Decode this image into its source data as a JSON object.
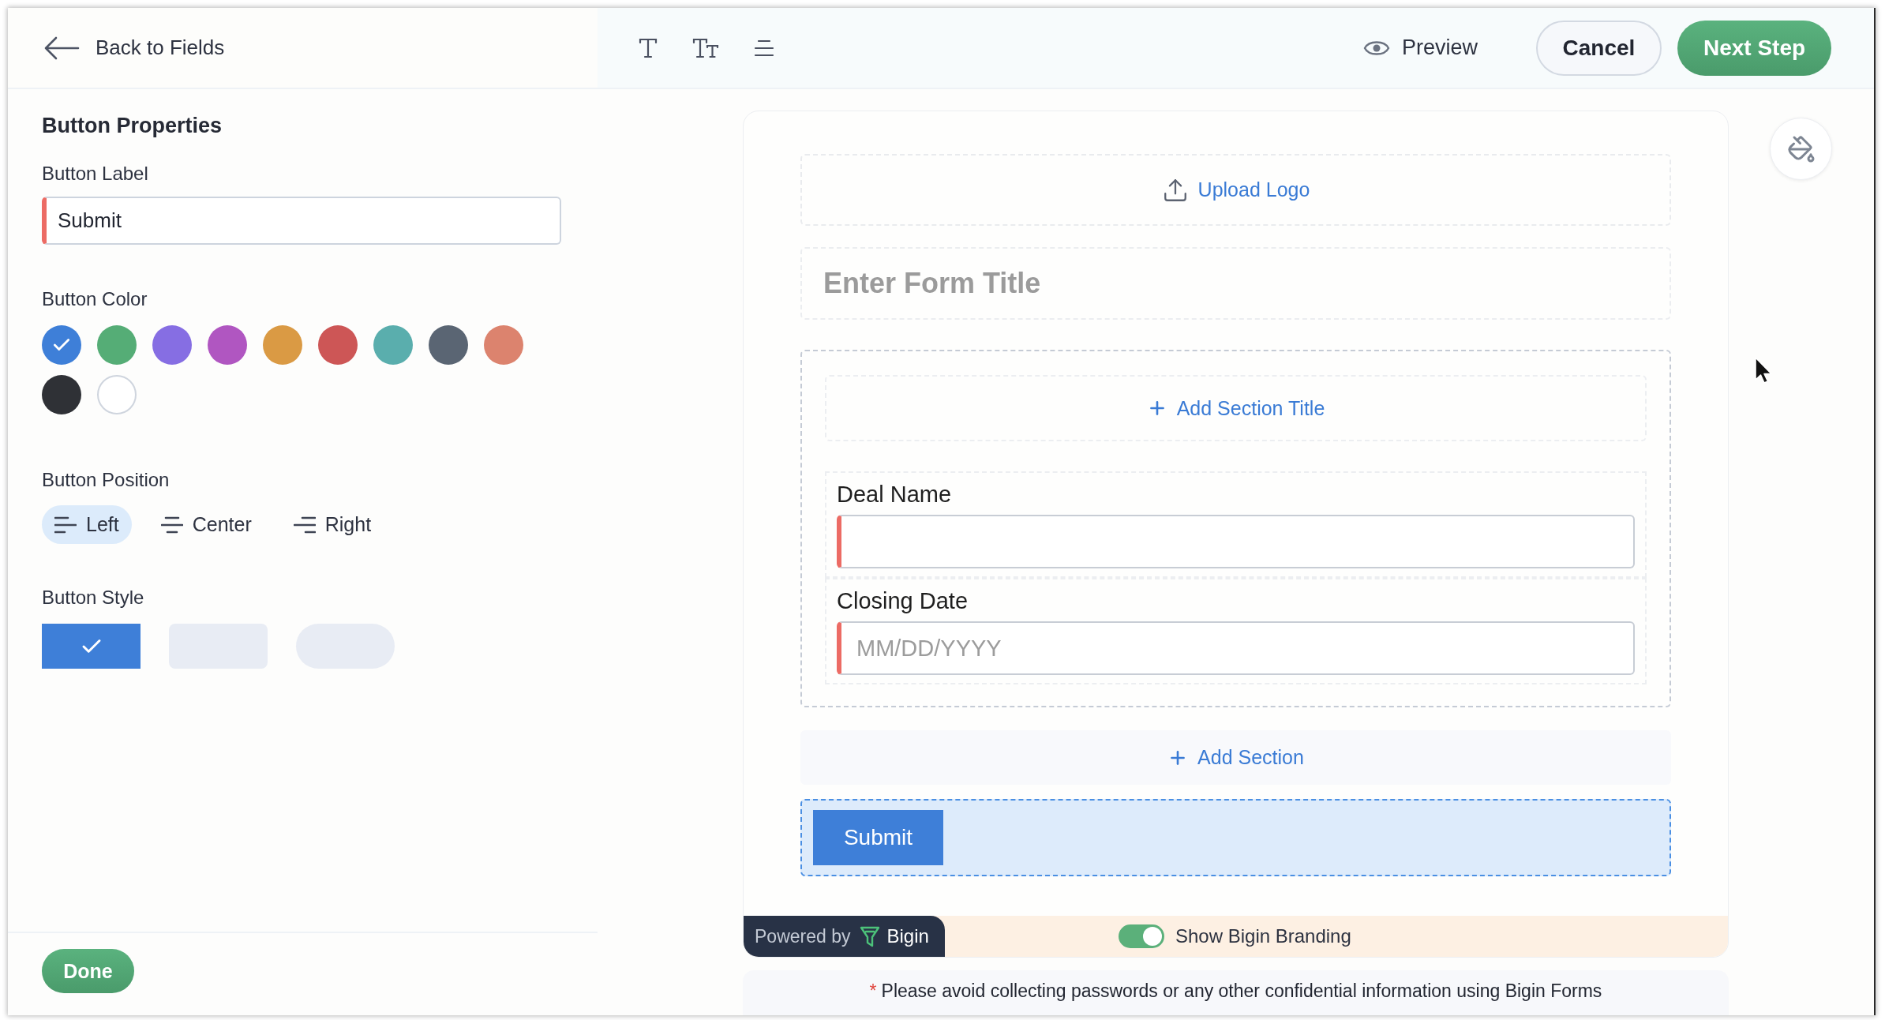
{
  "top_bar": {
    "back_link": "Back to Fields",
    "preview": "Preview",
    "buttons": [
      {
        "label": "Cancel",
        "kind": "secondary"
      },
      {
        "label": "Next Step",
        "kind": "primary"
      }
    ]
  },
  "properties_panel": {
    "title": "Button Properties",
    "label_field": {
      "label": "Button Label",
      "value": "Submit",
      "required": true
    },
    "color": {
      "label": "Button Color",
      "swatches": [
        {
          "color": "#3e7fd8",
          "selected": true
        },
        {
          "color": "#55ad76",
          "selected": false
        },
        {
          "color": "#866ee3",
          "selected": false
        },
        {
          "color": "#b056c1",
          "selected": false
        },
        {
          "color": "#da9a44",
          "selected": false
        },
        {
          "color": "#cd5656",
          "selected": false
        },
        {
          "color": "#5aaead",
          "selected": false
        },
        {
          "color": "#5a6573",
          "selected": false
        },
        {
          "color": "#dc836e",
          "selected": false
        },
        {
          "color": "#2f3136",
          "selected": false
        },
        {
          "color": "#ffffff",
          "selected": false
        }
      ]
    },
    "position": {
      "label": "Button Position",
      "options": [
        {
          "label": "Left",
          "kind": "left",
          "selected": true
        },
        {
          "label": "Center",
          "kind": "center",
          "selected": false
        },
        {
          "label": "Right",
          "kind": "right",
          "selected": false
        }
      ]
    },
    "style": {
      "label": "Button Style",
      "options": [
        {
          "kind": "square",
          "selected": true
        },
        {
          "kind": "rounded",
          "selected": false
        },
        {
          "kind": "pill",
          "selected": false
        }
      ]
    },
    "done_button": "Done"
  },
  "form": {
    "upload_logo": "Upload Logo",
    "title_placeholder": "Enter Form Title",
    "section": {
      "add_title": "Add Section Title",
      "fields": [
        {
          "label": "Deal Name",
          "required": true
        },
        {
          "label": "Closing Date",
          "placeholder": "MM/DD/YYYY",
          "required": true
        }
      ]
    },
    "add_section": "Add Section",
    "submit_label": "Submit",
    "branding": {
      "powered_by": "Powered by",
      "brand": "Bigin",
      "toggle_label": "Show Bigin Branding",
      "on": true
    },
    "notice": {
      "mark": "*",
      "text": "Please avoid collecting passwords or any other confidential information using Bigin Forms"
    }
  }
}
